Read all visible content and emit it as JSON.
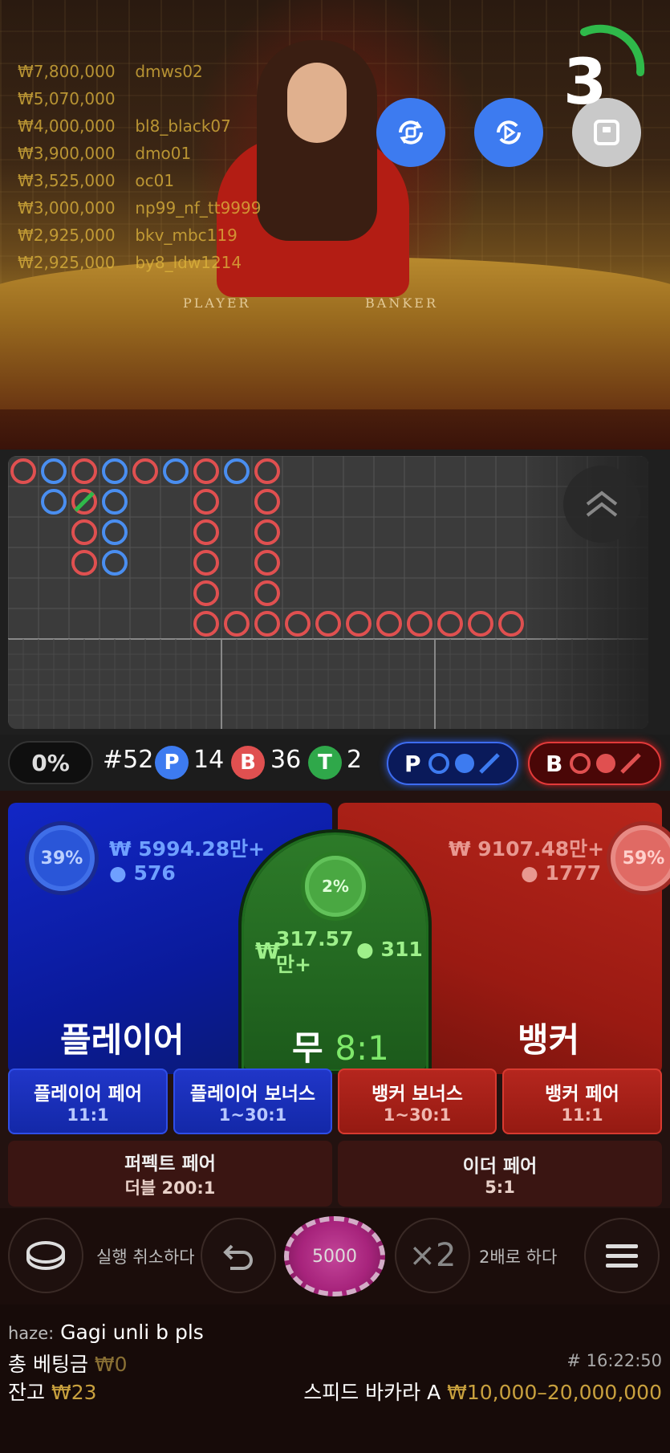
{
  "video": {
    "table_player_label": "PLAYER",
    "table_banker_label": "BANKER",
    "timer": "3",
    "leaderboard": [
      {
        "amount": "₩7,800,000",
        "user": "dmws02"
      },
      {
        "amount": "₩5,070,000",
        "user": ""
      },
      {
        "amount": "₩4,000,000",
        "user": "bl8_black07"
      },
      {
        "amount": "₩3,900,000",
        "user": "dmo01"
      },
      {
        "amount": "₩3,525,000",
        "user": "oc01"
      },
      {
        "amount": "₩3,000,000",
        "user": "np99_nf_tt9999"
      },
      {
        "amount": "₩2,925,000",
        "user": "bkv_mbc119"
      },
      {
        "amount": "₩2,925,000",
        "user": "by8_ldw1214"
      }
    ]
  },
  "stats": {
    "percent": "0%",
    "round": "#52",
    "player_letter": "P",
    "player_count": "14",
    "banker_letter": "B",
    "banker_count": "36",
    "tie_letter": "T",
    "tie_count": "2",
    "predict_player": "P",
    "predict_banker": "B"
  },
  "bets": {
    "player": {
      "label": "플레이어",
      "percent": "39%",
      "amount": "₩ 5994.28만+",
      "users": "576"
    },
    "banker": {
      "label": "뱅커",
      "percent": "59%",
      "amount": "₩ 9107.48만+",
      "users": "1777"
    },
    "tie": {
      "label": "무",
      "odds": "8:1",
      "percent": "2%",
      "amount_line1": "317.57",
      "amount_line2": "만+",
      "currency": "₩",
      "users": "311"
    },
    "side": [
      {
        "name": "플레이어 페어",
        "odds": "11:1"
      },
      {
        "name": "플레이어 보너스",
        "odds": "1~30:1"
      },
      {
        "name": "뱅커 보너스",
        "odds": "1~30:1"
      },
      {
        "name": "뱅커 페어",
        "odds": "11:1"
      },
      {
        "name": "퍼펙트 페어",
        "odds": "더블 200:1"
      },
      {
        "name": "이더 페어",
        "odds": "5:1"
      }
    ]
  },
  "controls": {
    "undo_label": "실행 취소하다",
    "chip_value": "5000",
    "double_symbol": "×2",
    "double_label": "2배로 하다"
  },
  "footer": {
    "chat_user": "haze:",
    "chat_msg": "Gagi unli b pls",
    "total_bet_label": "총 베팅금",
    "total_bet_value": "₩0",
    "balance_label": "잔고",
    "balance_value": "₩23",
    "round_time": "# 16:22:50",
    "table_name": "스피드 바카라 A",
    "limits": "₩10,000–20,000,000"
  },
  "colors": {
    "player": "#3d7bf0",
    "banker": "#e05050",
    "tie": "#2fa84a",
    "gold": "#c9a13e"
  },
  "icons": [
    "rotate-camera-icon",
    "video-settings-icon",
    "stop-icon",
    "chevron-up-icon",
    "chips-icon",
    "undo-icon",
    "menu-icon"
  ]
}
